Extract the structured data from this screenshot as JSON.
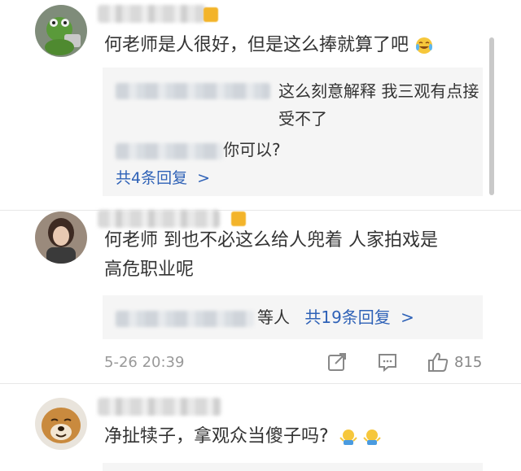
{
  "comments": [
    {
      "text": "何老师是人很好，但是这么捧就算了吧",
      "replies": [
        {
          "text": "这么刻意解释 我三观有点接受不了"
        },
        {
          "text": "你可以?"
        }
      ],
      "more_label": "共4条回复",
      "more_arrow": ">"
    },
    {
      "text_line1": "何老师 到也不必这么给人兜着 人家拍戏是",
      "text_line2": "高危职业呢",
      "reply_suffix": "等人",
      "more_label": "共19条回复",
      "more_arrow": ">",
      "time": "5-26 20:39",
      "like_count": "815"
    },
    {
      "text": "净扯犊子，拿观众当傻子吗?"
    }
  ],
  "icons": {
    "laugh_cry": "laugh-cry-emoji",
    "shrug": "shrug-emoji",
    "forward": "forward-icon",
    "comment": "comment-icon",
    "like": "thumbs-up-icon",
    "badge": "member-badge-icon"
  },
  "colors": {
    "link": "#2f62b7",
    "reply_bg": "#f5f5f5",
    "meta": "#999999",
    "badge": "#f3b42a"
  }
}
